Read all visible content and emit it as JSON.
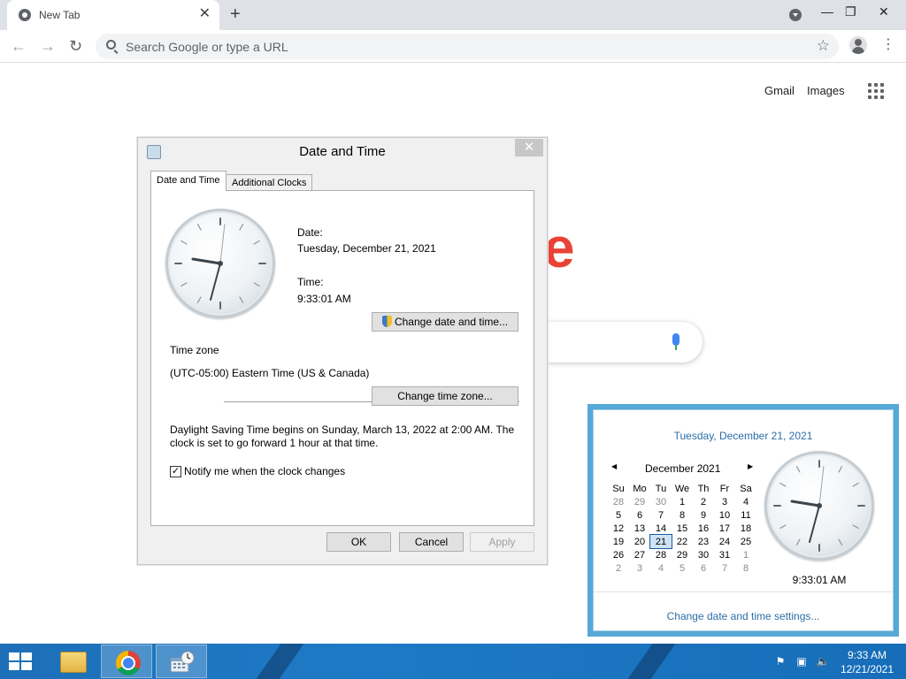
{
  "browser": {
    "tab_title": "New Tab",
    "tab_close": "✕",
    "new_tab": "+",
    "minimize": "—",
    "restore": "❐",
    "close": "✕",
    "back": "←",
    "forward": "→",
    "reload": "↻",
    "omnibox_placeholder": "Search Google or type a URL",
    "bookmark_star": "☆",
    "menu": "⋮"
  },
  "newtab_page": {
    "gmail": "Gmail",
    "images": "Images",
    "logo_fragment": "e"
  },
  "dialog": {
    "title": "Date and Time",
    "close": "✕",
    "tabs": [
      "Date and Time",
      "Additional Clocks"
    ],
    "date_label": "Date:",
    "date_value": "Tuesday, December 21, 2021",
    "time_label": "Time:",
    "time_value": "9:33:01 AM",
    "change_datetime_button": "Change date and time...",
    "timezone_heading": "Time zone",
    "timezone_value": "(UTC-05:00) Eastern Time (US & Canada)",
    "change_timezone_button": "Change time zone...",
    "dst_line1": "Daylight Saving Time begins on Sunday, March 13, 2022 at 2:00 AM. The",
    "dst_line2": "clock is set to go forward 1 hour at that time.",
    "notify_checked": true,
    "notify_check_mark": "✓",
    "notify_label": "Notify me when the clock changes",
    "ok": "OK",
    "cancel": "Cancel",
    "apply": "Apply"
  },
  "flyout": {
    "long_date": "Tuesday, December 21, 2021",
    "prev": "◀",
    "next": "▶",
    "month": "December 2021",
    "weekdays": [
      "Su",
      "Mo",
      "Tu",
      "We",
      "Th",
      "Fr",
      "Sa"
    ],
    "weeks": [
      [
        "28",
        "29",
        "30",
        "1",
        "2",
        "3",
        "4"
      ],
      [
        "5",
        "6",
        "7",
        "8",
        "9",
        "10",
        "11"
      ],
      [
        "12",
        "13",
        "14",
        "15",
        "16",
        "17",
        "18"
      ],
      [
        "19",
        "20",
        "21",
        "22",
        "23",
        "24",
        "25"
      ],
      [
        "26",
        "27",
        "28",
        "29",
        "30",
        "31",
        "1"
      ],
      [
        "2",
        "3",
        "4",
        "5",
        "6",
        "7",
        "8"
      ]
    ],
    "today": "21",
    "time": "9:33:01 AM",
    "settings_link": "Change date and time settings..."
  },
  "taskbar": {
    "clock_time": "9:33 AM",
    "clock_date": "12/21/2021",
    "tray_flag": "⚑",
    "tray_network": "▣",
    "tray_volume": "🔈"
  },
  "colors": {
    "accent_blue": "#2b6ea8",
    "taskbar": "#1e7ac6",
    "google_red": "#ea4335"
  }
}
